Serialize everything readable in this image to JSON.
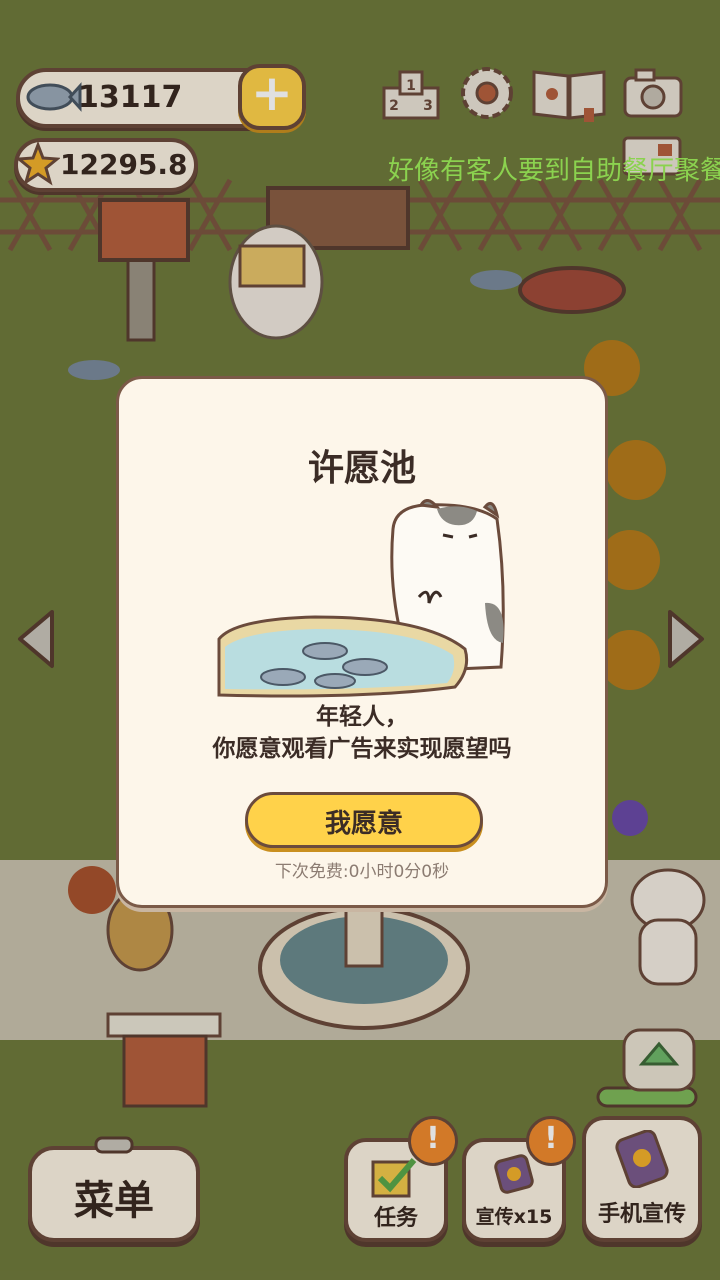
{
  "hud": {
    "fish_count": "13117",
    "star_count": "12295.8",
    "ticker": "好像有客人要到自助餐厅聚餐"
  },
  "dialog": {
    "title": "许愿池",
    "message_line1": "年轻人，",
    "message_line2": "你愿意观看广告来实现愿望吗",
    "confirm_label": "我愿意",
    "free_timer": "下次免费:0小时0分0秒"
  },
  "bottom": {
    "menu_label": "菜单",
    "task_label": "任务",
    "promo_label": "宣传x15",
    "phone_promo_label": "手机宣传",
    "alert_mark": "!"
  },
  "colors": {
    "accent_yellow": "#ffd24a",
    "ticker_green": "#9ff05a",
    "outline_brown": "#6b4b3c",
    "alert_orange": "#f08a2e"
  }
}
